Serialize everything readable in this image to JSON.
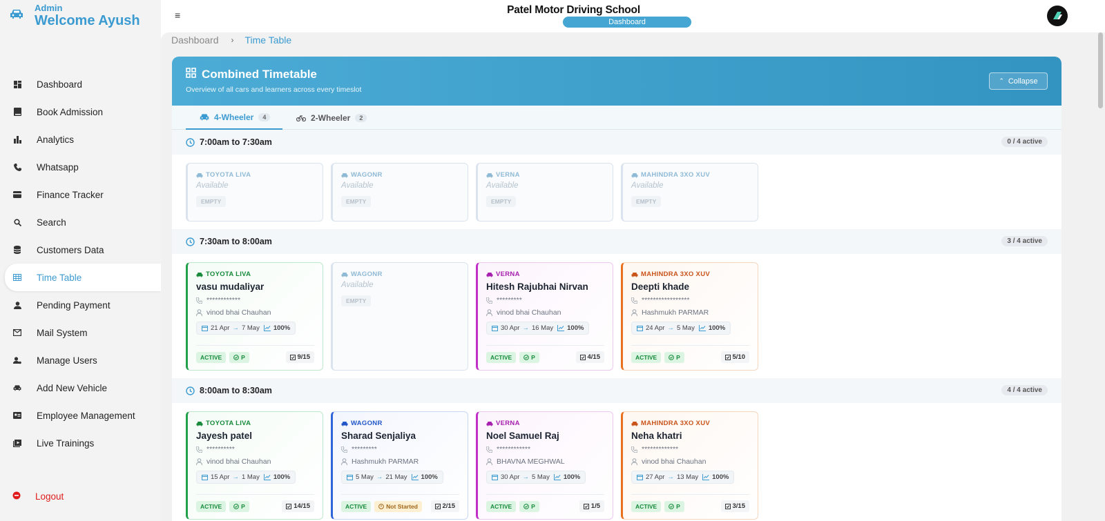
{
  "sidebar": {
    "role": "Admin",
    "welcome": "Welcome Ayush",
    "items": [
      {
        "label": "Dashboard"
      },
      {
        "label": "Book Admission"
      },
      {
        "label": "Analytics"
      },
      {
        "label": "Whatsapp"
      },
      {
        "label": "Finance Tracker"
      },
      {
        "label": "Search"
      },
      {
        "label": "Customers Data"
      },
      {
        "label": "Time Table"
      },
      {
        "label": "Pending Payment"
      },
      {
        "label": "Mail System"
      },
      {
        "label": "Manage Users"
      },
      {
        "label": "Add New Vehicle"
      },
      {
        "label": "Employee Management"
      },
      {
        "label": "Live Trainings"
      }
    ],
    "active_item": "Time Table",
    "logout": "Logout"
  },
  "header": {
    "school_name": "Patel Motor Driving School",
    "pill": "Dashboard"
  },
  "breadcrumb": {
    "first": "Dashboard",
    "separator": "›",
    "current": "Time Table"
  },
  "timetable": {
    "title": "Combined Timetable",
    "subtitle": "Overview of all cars and learners across every timeslot",
    "collapse_label": "Collapse",
    "tabs": [
      {
        "label": "4-Wheeler",
        "count": "4"
      },
      {
        "label": "2-Wheeler",
        "count": "2"
      }
    ],
    "available_text": "Available",
    "empty_text": "EMPTY",
    "slots": [
      {
        "time": "7:00am to 7:30am",
        "active": "0 / 4 active",
        "tiles": [
          {
            "vehicle": "TOYOTA LIVA"
          },
          {
            "vehicle": "WAGONR"
          },
          {
            "vehicle": "VERNA"
          },
          {
            "vehicle": "MAHINDRA 3XO XUV"
          }
        ]
      },
      {
        "time": "7:30am to 8:00am",
        "active": "3 / 4 active",
        "tiles": [
          {
            "vehicle": "TOYOTA LIVA",
            "name": "vasu mudaliyar",
            "phone": "************",
            "instructor": "vinod bhai Chauhan",
            "start": "21 Apr",
            "end": "7 May",
            "progress": "100%",
            "status": "ACTIVE",
            "att": "P",
            "count": "9/15"
          },
          {
            "vehicle": "WAGONR"
          },
          {
            "vehicle": "VERNA",
            "name": "Hitesh Rajubhai Nirvan",
            "phone": "*********",
            "instructor": "vinod bhai Chauhan",
            "start": "30 Apr",
            "end": "16 May",
            "progress": "100%",
            "status": "ACTIVE",
            "att": "P",
            "count": "4/15"
          },
          {
            "vehicle": "MAHINDRA 3XO XUV",
            "name": "Deepti khade",
            "phone": "*****************",
            "instructor": "Hashmukh PARMAR",
            "start": "24 Apr",
            "end": "5 May",
            "progress": "100%",
            "status": "ACTIVE",
            "att": "P",
            "count": "5/10"
          }
        ]
      },
      {
        "time": "8:00am to 8:30am",
        "active": "4 / 4 active",
        "tiles": [
          {
            "vehicle": "TOYOTA LIVA",
            "name": "Jayesh patel",
            "phone": "**********",
            "instructor": "vinod bhai Chauhan",
            "start": "15 Apr",
            "end": "1 May",
            "progress": "100%",
            "status": "ACTIVE",
            "att": "P",
            "count": "14/15"
          },
          {
            "vehicle": "WAGONR",
            "name": "Sharad Senjaliya",
            "phone": "*********",
            "instructor": "Hashmukh PARMAR",
            "start": "5 May",
            "end": "21 May",
            "progress": "100%",
            "status": "ACTIVE",
            "att": "Not Started",
            "count": "2/15"
          },
          {
            "vehicle": "VERNA",
            "name": "Noel Samuel Raj",
            "phone": "************",
            "instructor": "BHAVNA MEGHWAL",
            "start": "30 Apr",
            "end": "5 May",
            "progress": "100%",
            "status": "ACTIVE",
            "att": "P",
            "count": "1/5"
          },
          {
            "vehicle": "MAHINDRA 3XO XUV",
            "name": "Neha khatri",
            "phone": "*************",
            "instructor": "vinod bhai Chauhan",
            "start": "27 Apr",
            "end": "13 May",
            "progress": "100%",
            "status": "ACTIVE",
            "att": "P",
            "count": "3/15"
          }
        ]
      }
    ]
  }
}
